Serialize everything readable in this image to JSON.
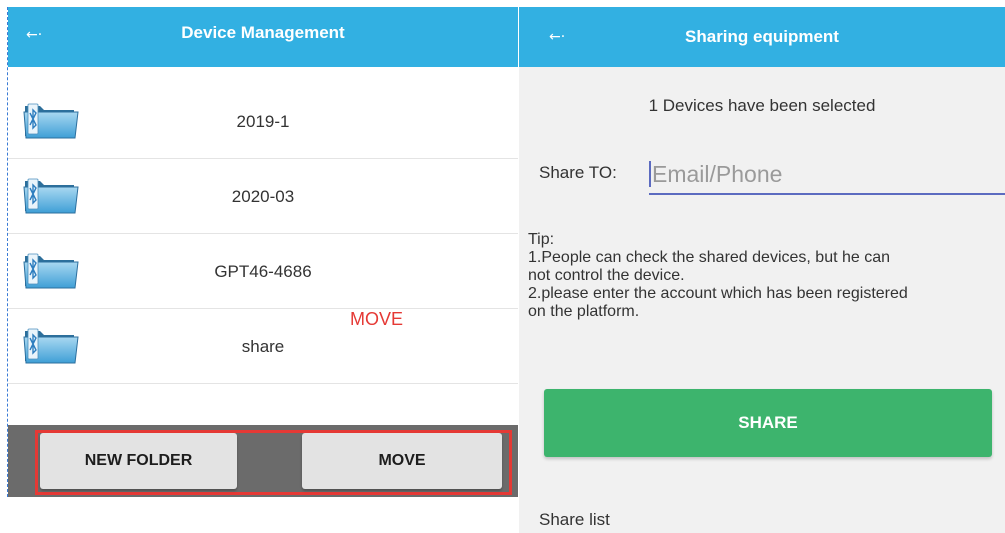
{
  "left_screen": {
    "header": {
      "back_glyph": "←·",
      "title": "Device Management"
    },
    "devices": [
      {
        "name": "2019-1",
        "icon": "bluetooth-folder-icon"
      },
      {
        "name": "2020-03",
        "icon": "bluetooth-folder-icon"
      },
      {
        "name": "GPT46-4686",
        "icon": "bluetooth-folder-icon"
      },
      {
        "name": "share",
        "icon": "bluetooth-folder-icon"
      }
    ],
    "annotation_label": "MOVE",
    "footer": {
      "new_folder_label": "NEW FOLDER",
      "move_label": "MOVE"
    }
  },
  "right_screen": {
    "header": {
      "back_glyph": "←·",
      "title": "Sharing equipment"
    },
    "selected_text": "1 Devices have been selected",
    "share_to": {
      "label": "Share TO:",
      "placeholder": "Email/Phone",
      "value": ""
    },
    "tip": {
      "heading": "Tip:",
      "line1": "1.People can check the shared devices, but he can\nnot control the device.",
      "line2": "2.please enter the account which has been registered\non the platform."
    },
    "share_button_label": "SHARE",
    "share_list_label": "Share list"
  },
  "colors": {
    "header_blue": "#32b0e2",
    "share_green": "#3db46d",
    "annotation_red": "#e53935",
    "input_underline": "#5c6bc0",
    "footer_gray": "#6b6b6b"
  }
}
